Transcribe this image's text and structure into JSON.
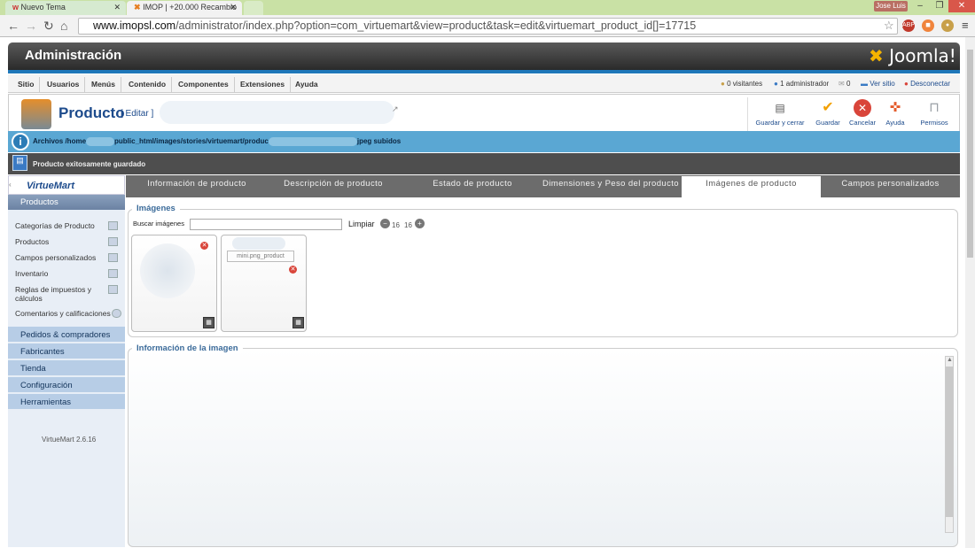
{
  "browser": {
    "tabs": [
      {
        "label": "Nuevo Tema"
      },
      {
        "label": "IMOP | +20.000 Recambio"
      }
    ],
    "user_badge": "Jose Luis",
    "url_prefix": "www.imopsl.com",
    "url_rest": "/administrator/index.php?option=com_virtuemart&view=product&task=edit&virtuemart_product_id[]=17715"
  },
  "header": {
    "title": "Administración",
    "logo_text": "Joomla!"
  },
  "menu": [
    "Sitio",
    "Usuarios",
    "Menús",
    "Contenido",
    "Componentes",
    "Extensiones",
    "Ayuda"
  ],
  "status": {
    "visitors": "0 visitantes",
    "admins": "1 administrador",
    "messages": "0",
    "view_site": "Ver sitio",
    "logout": "Desconectar"
  },
  "toolbar": {
    "title": "Producto",
    "subtitle": "[ Editar ]",
    "buttons": [
      {
        "label": "Guardar y cerrar",
        "color": "#555555"
      },
      {
        "label": "Guardar",
        "color": "#f2a000"
      },
      {
        "label": "Cancelar",
        "color": "#d9453a"
      },
      {
        "label": "Ayuda",
        "color": "#e45b2b"
      },
      {
        "label": "Permisos",
        "color": "#9aa0a6"
      }
    ]
  },
  "messages": {
    "info_start": "Archivos /home",
    "info_mid": "public_html/images/stories/virtuemart/produc",
    "info_end": "jpeg subidos",
    "saved": "Producto exitosamente guardado"
  },
  "sidebar": {
    "logo": "VirtueMart",
    "section": "Productos",
    "items": [
      "Categorías de Producto",
      "Productos",
      "Campos personalizados",
      "Inventario",
      "Reglas de impuestos y cálculos",
      "Comentarios y calificaciones"
    ],
    "groups": [
      "Pedidos & compradores",
      "Fabricantes",
      "Tienda",
      "Configuración",
      "Herramientas"
    ],
    "version": "VirtueMart 2.6.16"
  },
  "tabs": [
    "Información de producto",
    "Descripción de producto",
    "Estado de producto",
    "Dimensiones y Peso del producto",
    "Imágenes de producto",
    "Campos personalizados"
  ],
  "active_tab": "Imágenes de producto",
  "images": {
    "legend": "Imágenes",
    "search_label": "Buscar imágenes",
    "clear_label": "Limpiar",
    "page_a": "16",
    "page_b": "16",
    "thumb_filename": "mini.png_product"
  },
  "image_info": {
    "legend": "Información de la imagen"
  }
}
